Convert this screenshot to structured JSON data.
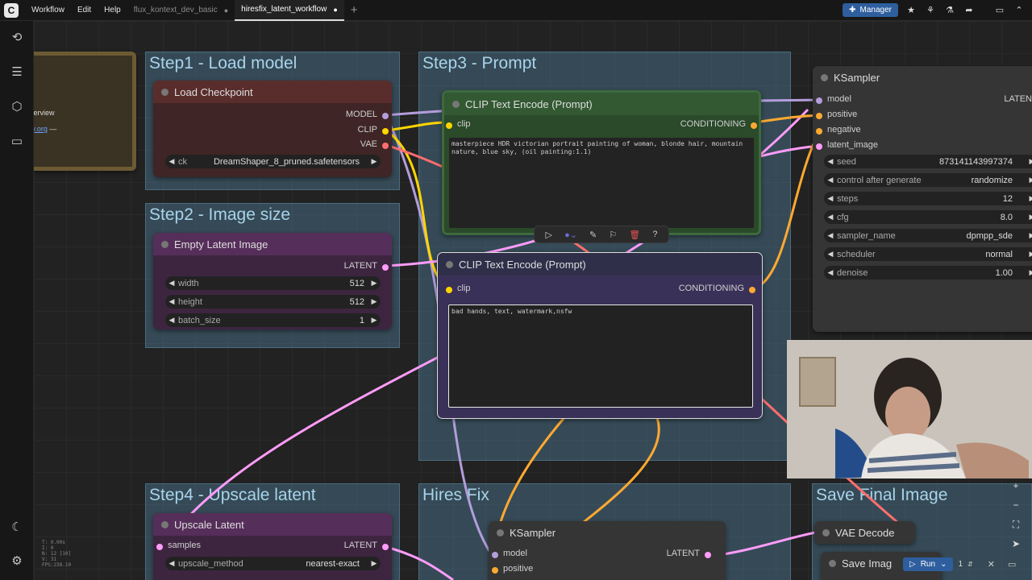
{
  "menu": {
    "app": "Workflow",
    "edit": "Edit",
    "help": "Help"
  },
  "tabs": [
    {
      "label": "flux_kontext_dev_basic",
      "dot": "●"
    },
    {
      "label": "hiresfix_latent_workflow",
      "dot": "●"
    }
  ],
  "newtab": "+",
  "manager_label": "Manager",
  "note": {
    "line1": "verview",
    "line2": "ty.org",
    "line3": "—"
  },
  "groups": {
    "step1": "Step1 - Load model",
    "step2": "Step2 - Image size",
    "step3": "Step3 - Prompt",
    "step4": "Step4 - Upscale latent",
    "hires": "Hires Fix",
    "save": "Save Final Image"
  },
  "load_checkpoint": {
    "title": "Load Checkpoint",
    "out_model": "MODEL",
    "out_clip": "CLIP",
    "out_vae": "VAE",
    "ckpt_label": "ck",
    "ckpt_value": "DreamShaper_8_pruned.safetensors"
  },
  "empty_latent": {
    "title": "Empty Latent Image",
    "out_latent": "LATENT",
    "width_label": "width",
    "width_value": "512",
    "height_label": "height",
    "height_value": "512",
    "batch_label": "batch_size",
    "batch_value": "1"
  },
  "clip_pos": {
    "title": "CLIP Text Encode (Prompt)",
    "in_clip": "clip",
    "out_cond": "CONDITIONING",
    "text": "masterpiece HDR victorian portrait painting of woman, blonde hair, mountain nature, blue sky, (oil painting:1.1)"
  },
  "clip_neg": {
    "title": "CLIP Text Encode (Prompt)",
    "in_clip": "clip",
    "out_cond": "CONDITIONING",
    "text": "bad hands, text, watermark,nsfw"
  },
  "ksampler": {
    "title": "KSampler",
    "in_model": "model",
    "in_positive": "positive",
    "in_negative": "negative",
    "in_latent": "latent_image",
    "out_latent": "LATEN",
    "seed_label": "seed",
    "seed_value": "873141143997374",
    "cag_label": "control after generate",
    "cag_value": "randomize",
    "steps_label": "steps",
    "steps_value": "12",
    "cfg_label": "cfg",
    "cfg_value": "8.0",
    "sampler_label": "sampler_name",
    "sampler_value": "dpmpp_sde",
    "scheduler_label": "scheduler",
    "scheduler_value": "normal",
    "denoise_label": "denoise",
    "denoise_value": "1.00"
  },
  "upscale_latent": {
    "title": "Upscale Latent",
    "in_samples": "samples",
    "out_latent": "LATENT",
    "method_label": "upscale_method",
    "method_value": "nearest-exact"
  },
  "ksampler2": {
    "title": "KSampler",
    "in_model": "model",
    "in_positive": "positive",
    "out_latent": "LATENT"
  },
  "vae_decode": {
    "title": "VAE Decode"
  },
  "save_image": {
    "title": "Save Imag"
  },
  "run": {
    "label": "Run",
    "count": "1"
  },
  "stats": {
    "t": "T: 0.00s",
    "i": "I: 0",
    "n": "N: 12 [10]",
    "v": "V: 31",
    "fps": "FPS:238.10"
  },
  "colors": {
    "model_wire": "#b39ddb",
    "clip_wire": "#ffd500",
    "vae_wire": "#ff6e6e",
    "latent_wire": "#ff9cf9",
    "cond_wire": "#ffa931",
    "accent": "#2e5e9e"
  },
  "icons": {
    "history": "history-icon",
    "nodes": "nodes-library-icon",
    "models": "cube-icon",
    "workflows": "folder-icon",
    "theme": "moon-icon",
    "settings": "gear-icon"
  }
}
